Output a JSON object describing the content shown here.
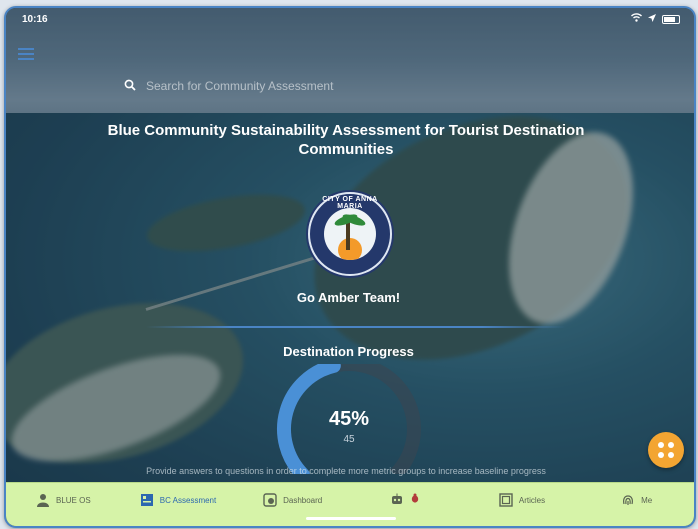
{
  "status_bar": {
    "time": "10:16"
  },
  "search": {
    "placeholder": "Search for Community Assessment"
  },
  "header": {
    "title": "Blue Community Sustainability Assessment for Tourist Destination Communities"
  },
  "logo": {
    "text": "CITY OF ANNA MARIA",
    "subtext": "MANATEE COUNTY FLORIDA"
  },
  "team": {
    "greeting": "Go Amber Team!"
  },
  "progress": {
    "title": "Destination Progress",
    "percent_label": "45%",
    "value_label": "45",
    "fraction": 0.45,
    "hint": "Provide answers to questions in order to complete more metric groups to increase baseline progress"
  },
  "colors": {
    "accent": "#4a84c4",
    "fab": "#f3a532",
    "tabbar": "#d6f3a8",
    "active_tab": "#2b67b0"
  },
  "tabs": [
    {
      "label": "BLUE OS",
      "icon": "person-icon",
      "active": false
    },
    {
      "label": "BC Assessment",
      "icon": "assessment-icon",
      "active": true
    },
    {
      "label": "Dashboard",
      "icon": "dashboard-icon",
      "active": false
    },
    {
      "label": "",
      "icon": "robot-icon",
      "active": false
    },
    {
      "label": "Articles",
      "icon": "articles-icon",
      "active": false
    },
    {
      "label": "Me",
      "icon": "fingerprint-icon",
      "active": false
    }
  ]
}
